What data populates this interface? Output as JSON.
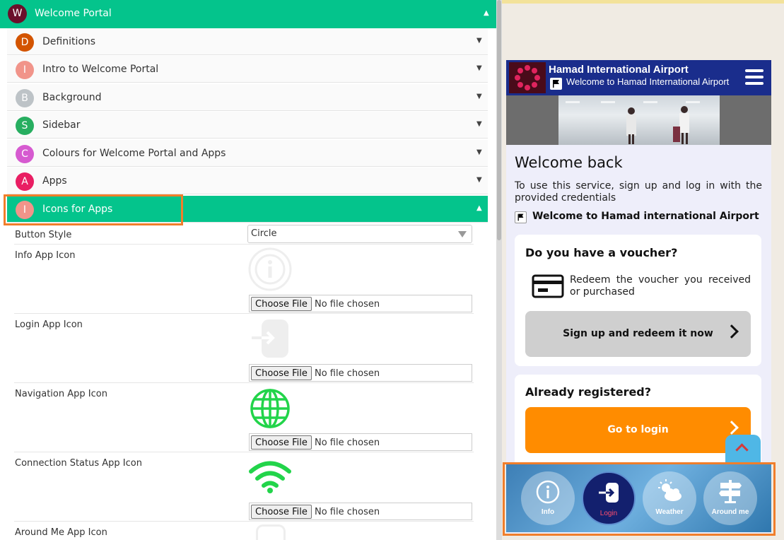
{
  "editor": {
    "header": {
      "avatar": "W",
      "title": "Welcome Portal",
      "avatar_color": "#6b0f2b",
      "color": "#04c48c"
    },
    "sections": [
      {
        "avatar": "D",
        "label": "Definitions",
        "color": "#d35400"
      },
      {
        "avatar": "I",
        "label": "Intro to Welcome Portal",
        "color": "#f1948a"
      },
      {
        "avatar": "B",
        "label": "Background",
        "color": "#bdc3c7"
      },
      {
        "avatar": "S",
        "label": "Sidebar",
        "color": "#27ae60"
      },
      {
        "avatar": "C",
        "label": "Colours for Welcome Portal and Apps",
        "color": "#d65ad0"
      },
      {
        "avatar": "A",
        "label": "Apps",
        "color": "#e91e63"
      },
      {
        "avatar": "I",
        "label": "Icons for Apps",
        "color": "#f1948a"
      }
    ],
    "button_style": {
      "label": "Button Style",
      "value": "Circle"
    },
    "fields": [
      {
        "label": "Info App Icon",
        "button": "Choose File",
        "status": "No file chosen",
        "icon": "info-icon"
      },
      {
        "label": "Login App Icon",
        "button": "Choose File",
        "status": "No file chosen",
        "icon": "login-icon"
      },
      {
        "label": "Navigation App Icon",
        "button": "Choose File",
        "status": "No file chosen",
        "icon": "globe-icon"
      },
      {
        "label": "Connection Status App Icon",
        "button": "Choose File",
        "status": "No file chosen",
        "icon": "wifi-icon"
      },
      {
        "label": "Around Me App Icon"
      }
    ]
  },
  "preview": {
    "title": "Hamad International Airport",
    "subtitle": "Welcome to Hamad International Airport",
    "heading": "Welcome back",
    "description": "To use this service, sign up and log in with the provided credentials",
    "welcome": "Welcome to Hamad international Airport",
    "voucher": {
      "title": "Do you have a voucher?",
      "text": "Redeem the voucher you received or purchased",
      "button": "Sign up and redeem it now"
    },
    "registered": {
      "title": "Already registered?",
      "button": "Go to login",
      "button_color": "#ff8c00"
    },
    "dock": [
      {
        "label": "Info",
        "icon": "info-icon"
      },
      {
        "label": "Login",
        "icon": "login-icon"
      },
      {
        "label": "Weather",
        "icon": "weather-icon"
      },
      {
        "label": "Around me",
        "icon": "signpost-icon"
      }
    ]
  }
}
